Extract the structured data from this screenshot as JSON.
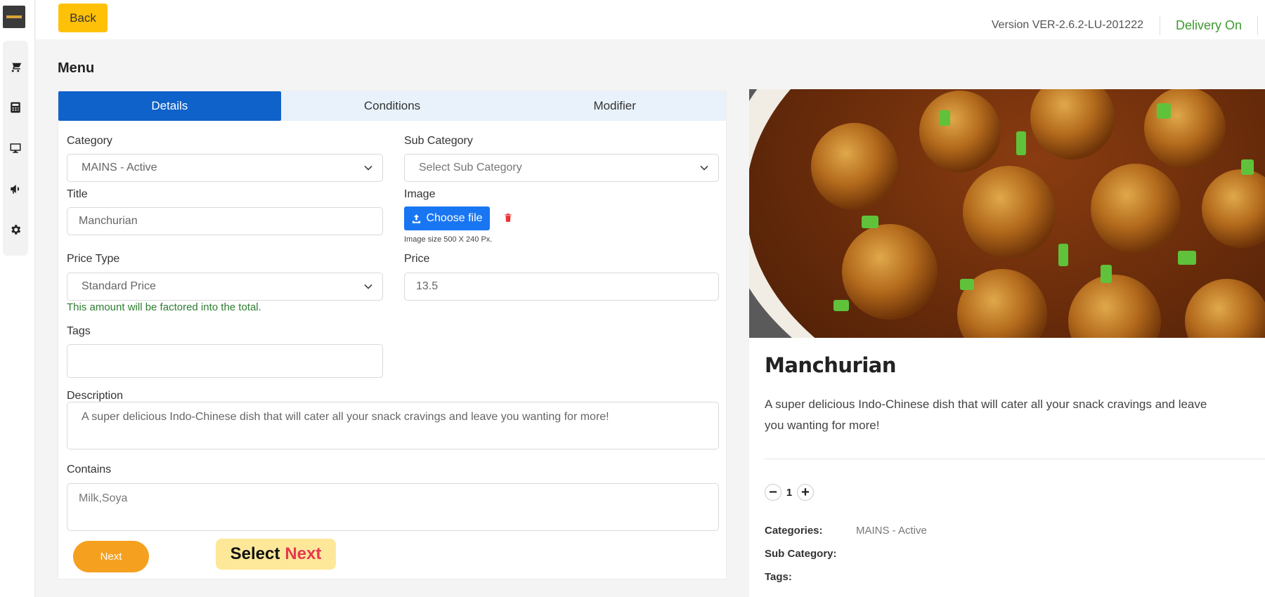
{
  "header": {
    "back_label": "Back",
    "version": "Version VER-2.6.2-LU-201222",
    "delivery": "Delivery On"
  },
  "sidebar": {
    "items": [
      {
        "icon": "cart-icon"
      },
      {
        "icon": "calculator-icon"
      },
      {
        "icon": "monitor-icon"
      },
      {
        "icon": "megaphone-icon"
      },
      {
        "icon": "gear-icon"
      }
    ]
  },
  "page": {
    "title": "Menu"
  },
  "tabs": [
    {
      "label": "Details",
      "active": true
    },
    {
      "label": "Conditions",
      "active": false
    },
    {
      "label": "Modifier",
      "active": false
    }
  ],
  "form": {
    "category": {
      "label": "Category",
      "value": "MAINS - Active"
    },
    "sub_category": {
      "label": "Sub Category",
      "placeholder": "Select Sub Category"
    },
    "title": {
      "label": "Title",
      "value": "Manchurian"
    },
    "image": {
      "label": "Image",
      "button": "Choose file",
      "hint": "Image size 500 X 240 Px."
    },
    "price_type": {
      "label": "Price Type",
      "value": "Standard Price",
      "note": "This amount will be factored into the total."
    },
    "price": {
      "label": "Price",
      "value": "13.5"
    },
    "tags": {
      "label": "Tags",
      "value": ""
    },
    "description": {
      "label": "Description",
      "value": "A super delicious Indo-Chinese dish that will cater all your snack cravings and leave you wanting for more!"
    },
    "contains": {
      "label": "Contains",
      "value": "Milk,Soya"
    },
    "next_label": "Next",
    "hint": {
      "prefix": "Select",
      "accent": "Next"
    }
  },
  "preview": {
    "title": "Manchurian",
    "description": "A super delicious Indo-Chinese dish that will cater all your snack cravings and leave you wanting for more!",
    "quantity": "1",
    "minus": "−",
    "plus": "+",
    "categories_label": "Categories:",
    "categories_value": "MAINS - Active",
    "sub_category_label": "Sub Category:",
    "tags_label": "Tags:"
  },
  "colors": {
    "accent_blue": "#0f62c9",
    "button_yellow": "#ffc107",
    "next_orange": "#f6a020",
    "delivery_green": "#3c9a2e"
  }
}
